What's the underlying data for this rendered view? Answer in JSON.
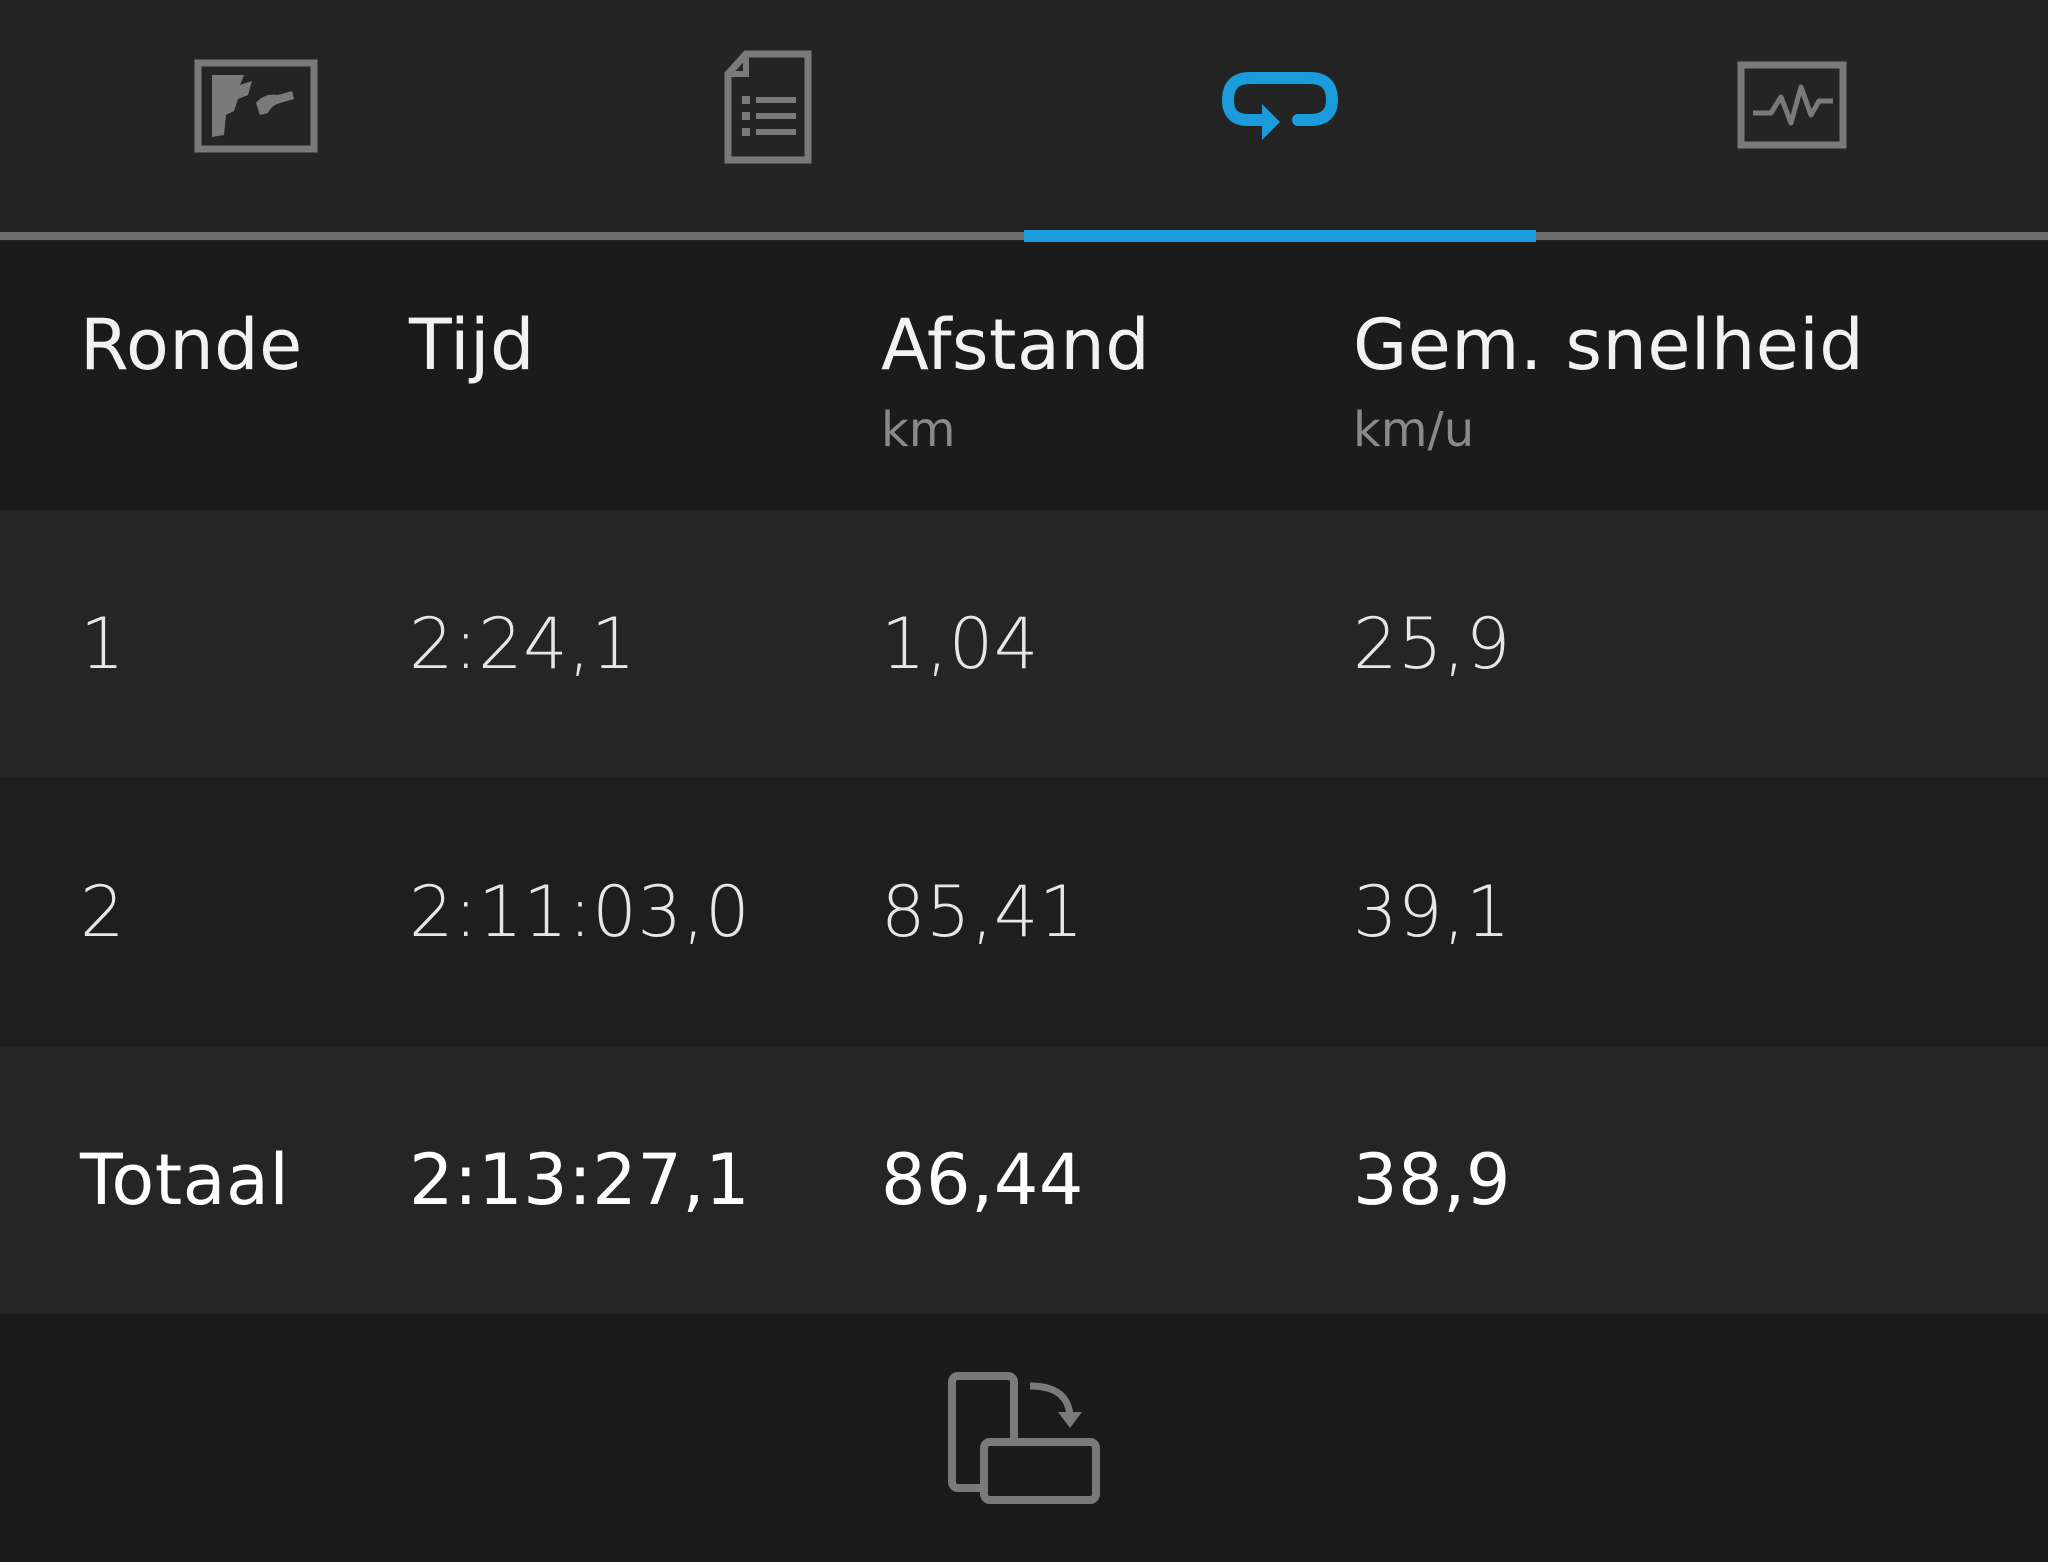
{
  "tabs": [
    {
      "id": "map",
      "icon": "map-icon",
      "selected": false
    },
    {
      "id": "details",
      "icon": "document-list-icon",
      "selected": false
    },
    {
      "id": "laps",
      "icon": "loop-arrow-icon",
      "selected": true
    },
    {
      "id": "charts",
      "icon": "activity-chart-icon",
      "selected": false
    }
  ],
  "colors": {
    "accent": "#1a9bdc",
    "background": "#1b1b1b",
    "tab_bar": "#242424",
    "icon_inactive": "#7a7a7a",
    "unit_text": "#8a8a8a"
  },
  "table": {
    "columns": [
      {
        "label": "Ronde",
        "unit": ""
      },
      {
        "label": "Tijd",
        "unit": ""
      },
      {
        "label": "Afstand",
        "unit": "km"
      },
      {
        "label": "Gem. snelheid",
        "unit": "km/u"
      }
    ],
    "rows": [
      {
        "lap": "1",
        "time": "2:24,1",
        "distance": "1,04",
        "avg_speed": "25,9"
      },
      {
        "lap": "2",
        "time": "2:11:03,0",
        "distance": "85,41",
        "avg_speed": "39,1"
      }
    ],
    "total": {
      "lap": "Totaal",
      "time": "2:13:27,1",
      "distance": "86,44",
      "avg_speed": "38,9"
    }
  },
  "bottom": {
    "icon": "rotate-screen-icon"
  }
}
